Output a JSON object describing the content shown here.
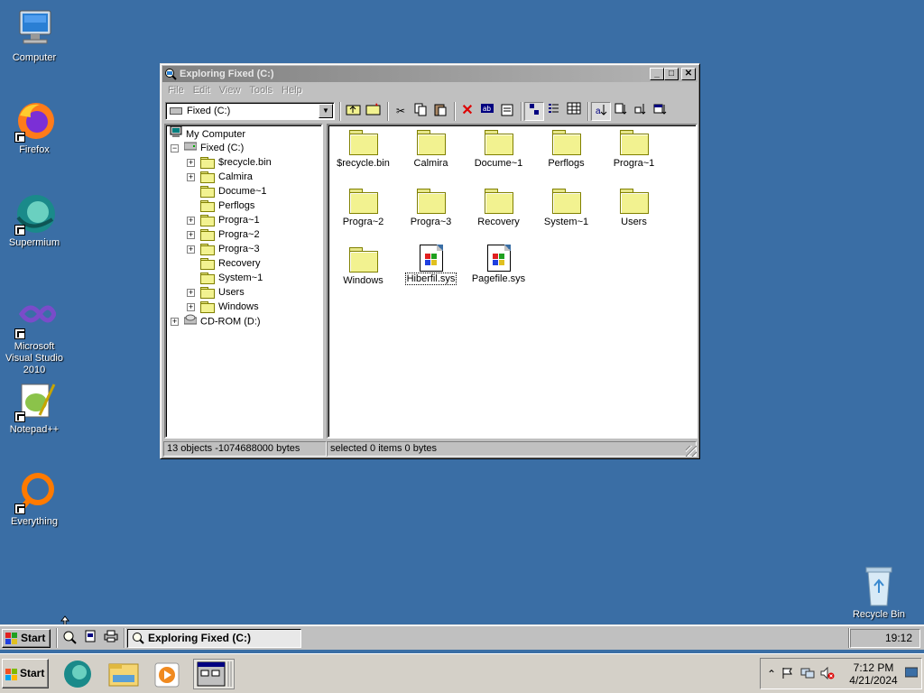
{
  "desktop": {
    "icons": [
      {
        "label": "Computer"
      },
      {
        "label": "Firefox"
      },
      {
        "label": "Supermium"
      },
      {
        "label": "Microsoft Visual Studio 2010"
      },
      {
        "label": "Notepad++"
      },
      {
        "label": "Everything"
      },
      {
        "label": "Recycle Bin"
      }
    ]
  },
  "window": {
    "title": "Exploring Fixed (C:)",
    "buttons": {
      "minimize": "_",
      "maximize": "□",
      "close": "✕"
    },
    "menu": [
      "File",
      "Edit",
      "View",
      "Tools",
      "Help"
    ],
    "address": {
      "value": "Fixed (C:)"
    },
    "toolbar": [
      "up-one-level",
      "map-network-drive",
      "cut",
      "copy",
      "paste",
      "delete",
      "rename",
      "properties",
      "large-icons",
      "list",
      "details",
      "sort-name",
      "sort-type",
      "sort-size",
      "sort-date"
    ],
    "tree": [
      {
        "label": "My Computer"
      },
      {
        "label": "Fixed (C:)"
      },
      {
        "label": "$recycle.bin"
      },
      {
        "label": "Calmira"
      },
      {
        "label": "Docume~1"
      },
      {
        "label": "Perflogs"
      },
      {
        "label": "Progra~1"
      },
      {
        "label": "Progra~2"
      },
      {
        "label": "Progra~3"
      },
      {
        "label": "Recovery"
      },
      {
        "label": "System~1"
      },
      {
        "label": "Users"
      },
      {
        "label": "Windows"
      },
      {
        "label": "CD-ROM (D:)"
      }
    ],
    "files": [
      {
        "label": "$recycle.bin",
        "type": "folder"
      },
      {
        "label": "Calmira",
        "type": "folder"
      },
      {
        "label": "Docume~1",
        "type": "folder"
      },
      {
        "label": "Perflogs",
        "type": "folder"
      },
      {
        "label": "Progra~1",
        "type": "folder"
      },
      {
        "label": "Progra~2",
        "type": "folder"
      },
      {
        "label": "Progra~3",
        "type": "folder"
      },
      {
        "label": "Recovery",
        "type": "folder"
      },
      {
        "label": "System~1",
        "type": "folder"
      },
      {
        "label": "Users",
        "type": "folder"
      },
      {
        "label": "Windows",
        "type": "folder"
      },
      {
        "label": "Hiberfil.sys",
        "type": "system-file"
      },
      {
        "label": "Pagefile.sys",
        "type": "system-file"
      }
    ],
    "status": {
      "objects": "13 objects  -1074688000 bytes",
      "selected": "selected 0 items   0 bytes"
    }
  },
  "calmira_taskbar": {
    "start_label": "Start",
    "task_label": "Exploring Fixed (C:)",
    "clock": "19:12"
  },
  "windows_taskbar": {
    "start_label": "Start",
    "time": "7:12 PM",
    "date": "4/21/2024"
  }
}
